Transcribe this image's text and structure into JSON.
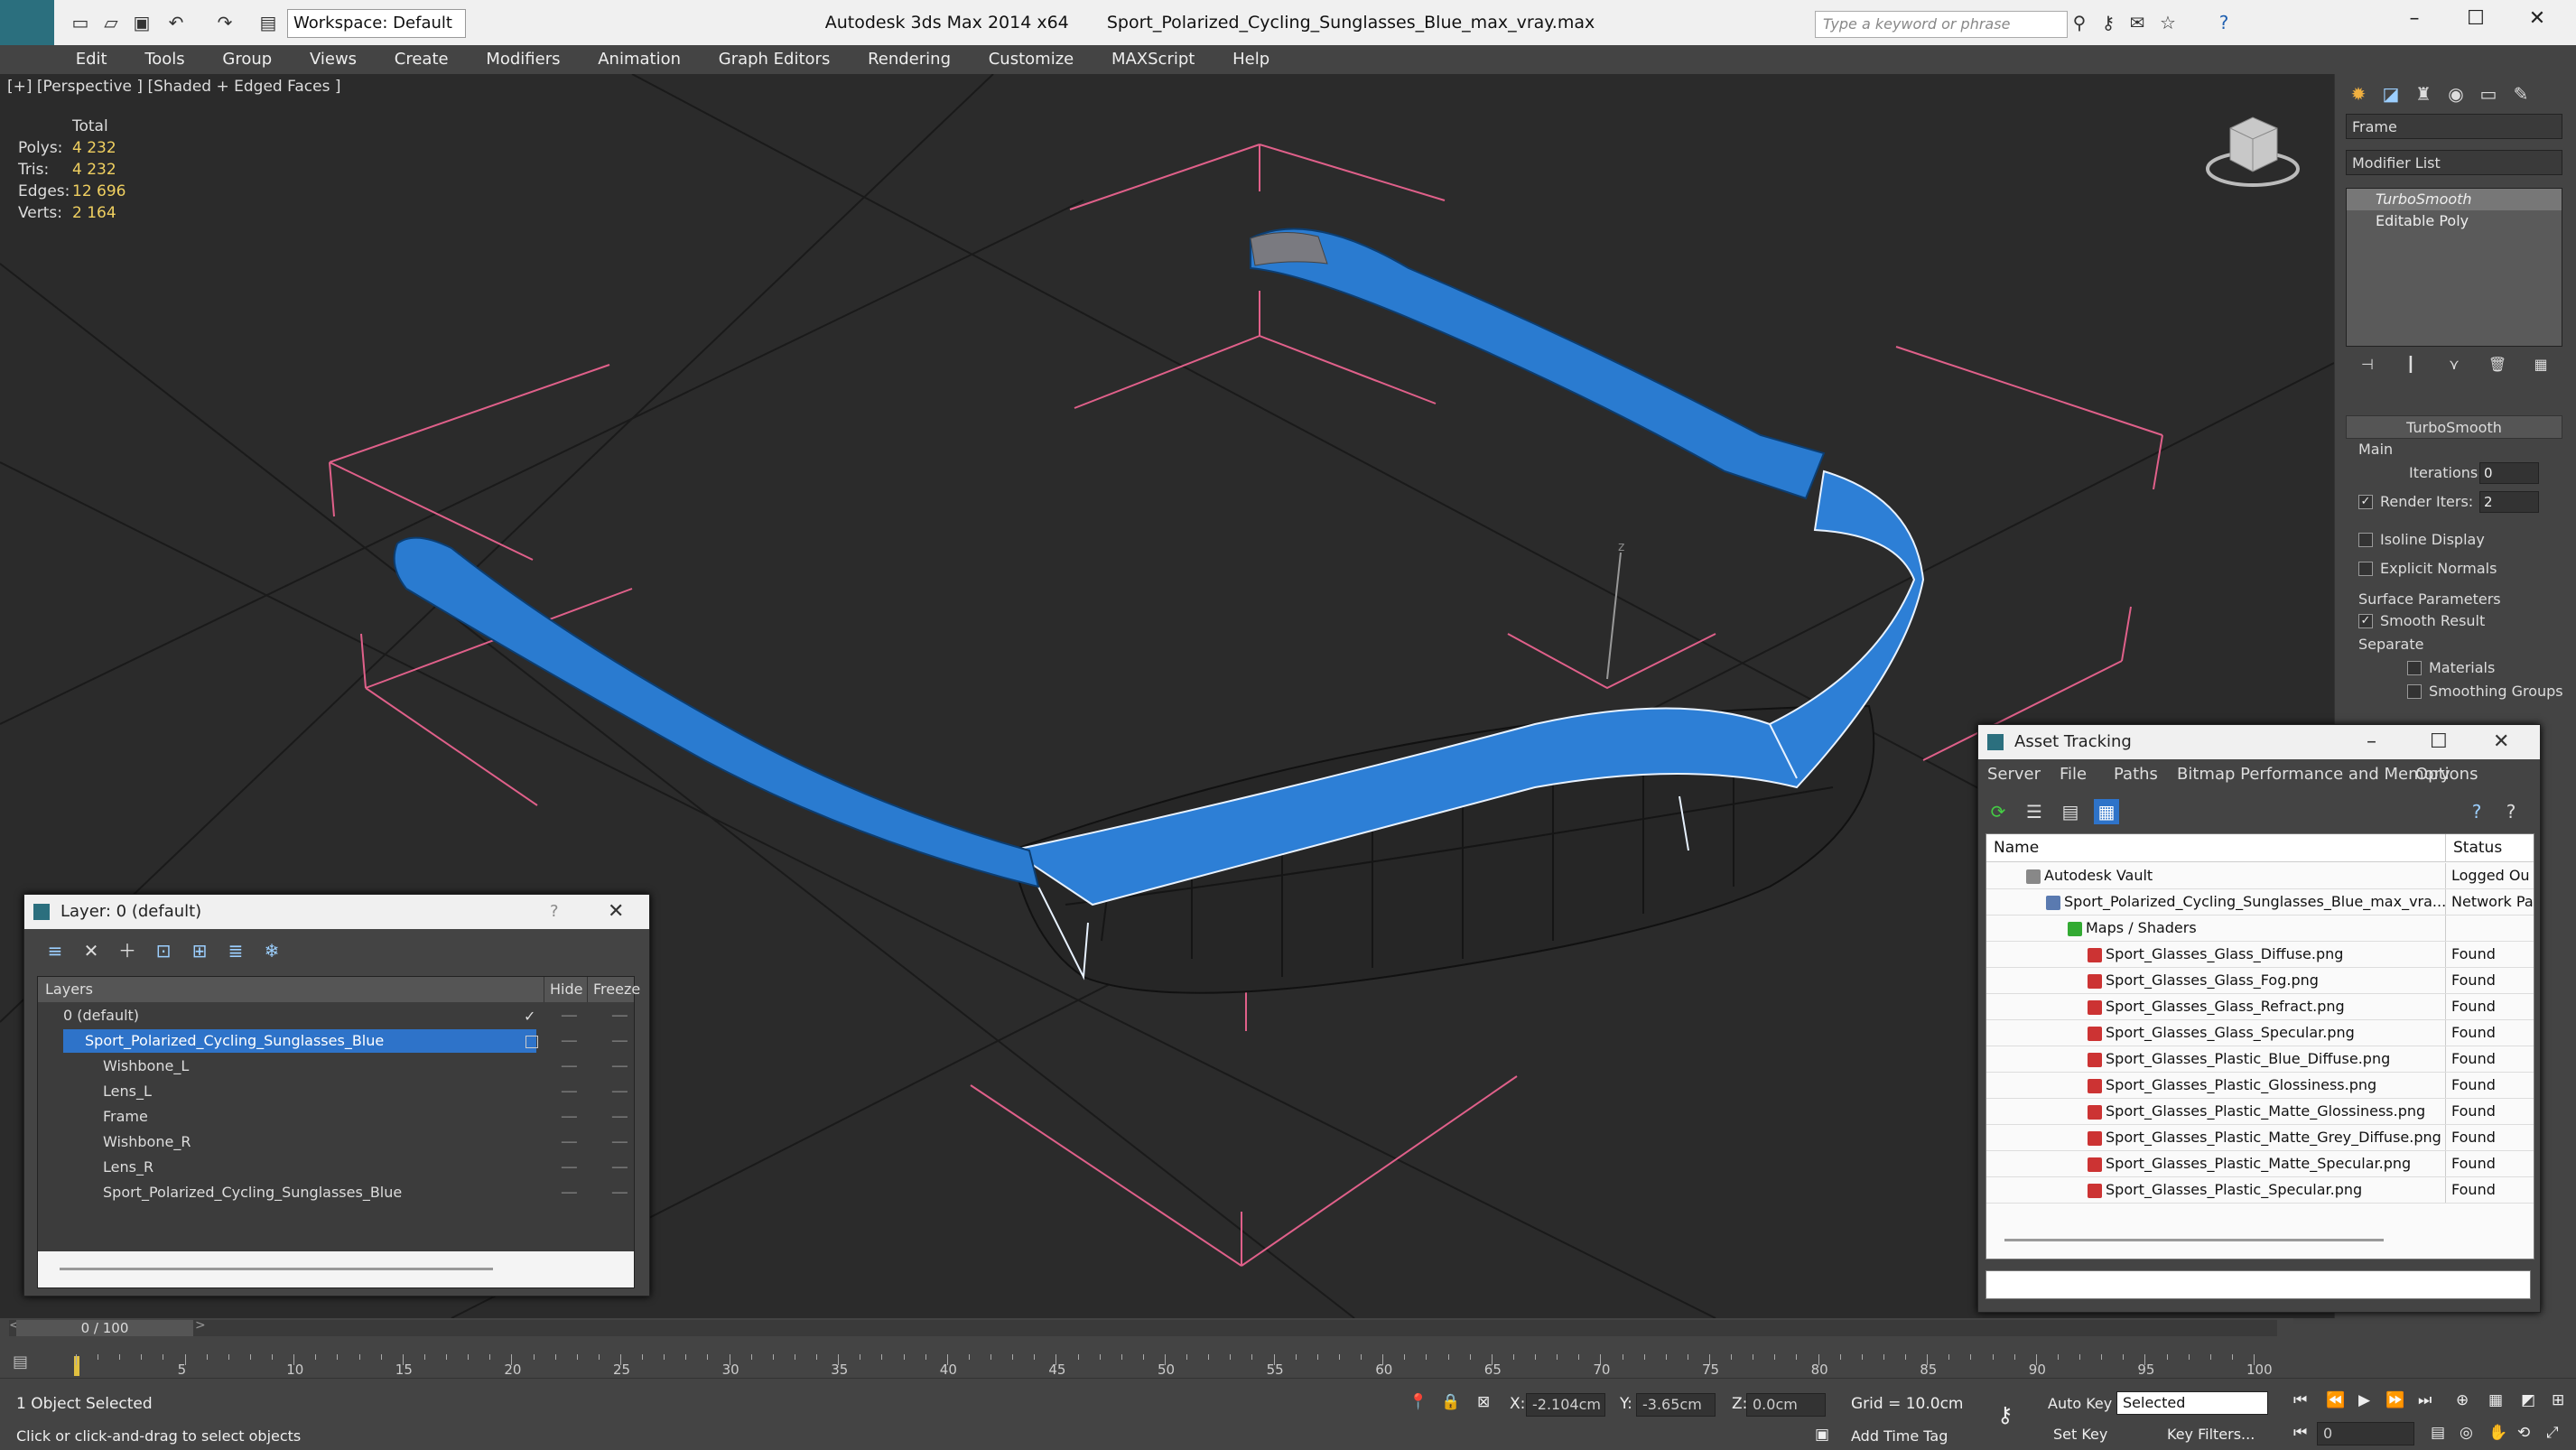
{
  "window": {
    "workspace": "Workspace: Default",
    "title_app": "Autodesk 3ds Max  2014 x64",
    "title_file": "Sport_Polarized_Cycling_Sunglasses_Blue_max_vray.max",
    "search_placeholder": "Type a keyword or phrase"
  },
  "menu": [
    "Edit",
    "Tools",
    "Group",
    "Views",
    "Create",
    "Modifiers",
    "Animation",
    "Graph Editors",
    "Rendering",
    "Customize",
    "MAXScript",
    "Help"
  ],
  "viewport": {
    "label": "[+] [Perspective ] [Shaded + Edged Faces ]",
    "stats": {
      "header": "Total",
      "polys_label": "Polys:",
      "polys": "4 232",
      "tris_label": "Tris:",
      "tris": "4 232",
      "edges_label": "Edges:",
      "edges": "12 696",
      "verts_label": "Verts:",
      "verts": "2 164"
    }
  },
  "command_panel": {
    "object_name": "Frame",
    "modifier_list": "Modifier List",
    "stack": [
      "TurboSmooth",
      "Editable Poly"
    ],
    "rollout_title": "TurboSmooth",
    "main_label": "Main",
    "iterations_label": "Iterations:",
    "iterations": "0",
    "render_iters_label": "Render Iters:",
    "render_iters": "2",
    "isoline_display": "Isoline Display",
    "explicit_normals": "Explicit Normals",
    "surface_params": "Surface Parameters",
    "smooth_result": "Smooth Result",
    "separate": "Separate",
    "materials": "Materials",
    "smoothing_groups": "Smoothing Groups"
  },
  "layer_dialog": {
    "title": "Layer: 0 (default)",
    "help": "?",
    "close": "✕",
    "col_layers": "Layers",
    "col_hide": "Hide",
    "col_freeze": "Freeze",
    "rows": [
      {
        "name": "0 (default)",
        "check": "✓"
      },
      {
        "name": "Sport_Polarized_Cycling_Sunglasses_Blue"
      },
      {
        "name": "Wishbone_L"
      },
      {
        "name": "Lens_L"
      },
      {
        "name": "Frame"
      },
      {
        "name": "Wishbone_R"
      },
      {
        "name": "Lens_R"
      },
      {
        "name": "Sport_Polarized_Cycling_Sunglasses_Blue"
      }
    ]
  },
  "asset_dialog": {
    "title": "Asset Tracking",
    "menu": [
      "Server",
      "File",
      "Paths",
      "Bitmap Performance and Memory",
      "Options"
    ],
    "col_name": "Name",
    "col_status": "Status",
    "rows": [
      {
        "name": "Autodesk Vault",
        "status": "Logged Ou"
      },
      {
        "name": "Sport_Polarized_Cycling_Sunglasses_Blue_max_vra...",
        "status": "Network Pa"
      },
      {
        "name": "Maps / Shaders",
        "status": ""
      },
      {
        "name": "Sport_Glasses_Glass_Diffuse.png",
        "status": "Found"
      },
      {
        "name": "Sport_Glasses_Glass_Fog.png",
        "status": "Found"
      },
      {
        "name": "Sport_Glasses_Glass_Refract.png",
        "status": "Found"
      },
      {
        "name": "Sport_Glasses_Glass_Specular.png",
        "status": "Found"
      },
      {
        "name": "Sport_Glasses_Plastic_Blue_Diffuse.png",
        "status": "Found"
      },
      {
        "name": "Sport_Glasses_Plastic_Glossiness.png",
        "status": "Found"
      },
      {
        "name": "Sport_Glasses_Plastic_Matte_Glossiness.png",
        "status": "Found"
      },
      {
        "name": "Sport_Glasses_Plastic_Matte_Grey_Diffuse.png",
        "status": "Found"
      },
      {
        "name": "Sport_Glasses_Plastic_Matte_Specular.png",
        "status": "Found"
      },
      {
        "name": "Sport_Glasses_Plastic_Specular.png",
        "status": "Found"
      }
    ]
  },
  "timeline": {
    "frame": "0 / 100",
    "ticks": [
      "5",
      "10",
      "15",
      "20",
      "25",
      "30",
      "35",
      "40",
      "45",
      "50",
      "55",
      "60",
      "65",
      "70",
      "75",
      "80",
      "85",
      "90",
      "95",
      "100"
    ]
  },
  "status": {
    "selected": "1 Object Selected",
    "hint": "Click or click-and-drag to select objects",
    "x_label": "X:",
    "x": "-2.104cm",
    "y_label": "Y:",
    "y": "-3.65cm",
    "z_label": "Z:",
    "z": "0.0cm",
    "grid": "Grid = 10.0cm",
    "add_time_tag": "Add Time Tag",
    "auto_key": "Auto Key",
    "set_key": "Set Key",
    "selected_dropdown": "Selected",
    "key_filters": "Key Filters...",
    "frame_field": "0"
  }
}
